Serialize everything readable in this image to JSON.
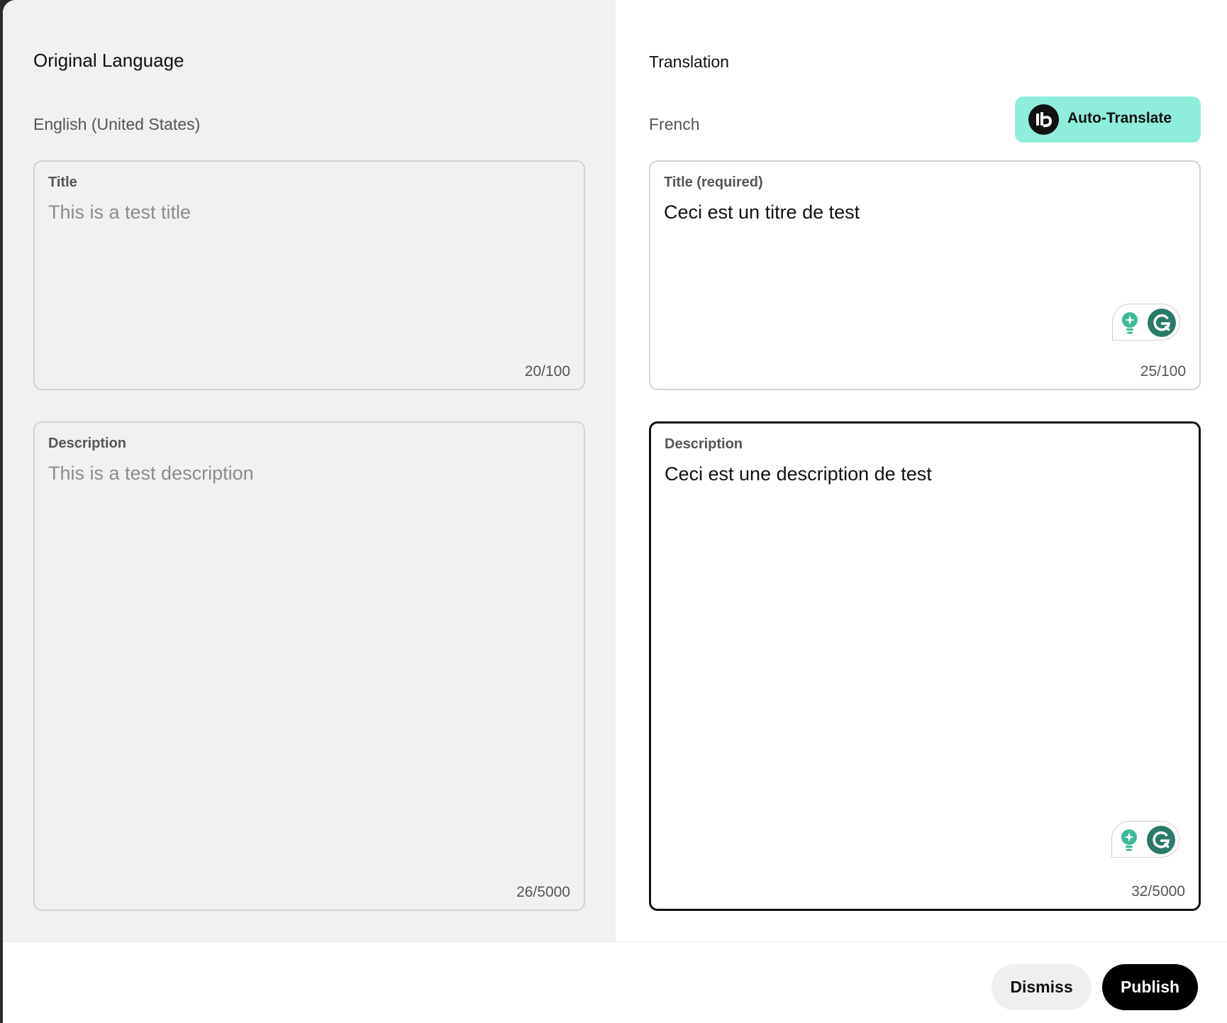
{
  "original": {
    "heading": "Original Language",
    "language": "English (United States)",
    "title_field": {
      "label": "Title",
      "value": "This is a test title",
      "counter": "20/100"
    },
    "description_field": {
      "label": "Description",
      "value": "This is a test description",
      "counter": "26/5000"
    }
  },
  "translation": {
    "heading": "Translation",
    "language": "French",
    "auto_translate_label": "Auto-Translate",
    "title_field": {
      "label": "Title (required)",
      "value": "Ceci est un titre de test",
      "counter": "25/100"
    },
    "description_field": {
      "label": "Description",
      "value": "Ceci est une description de test",
      "counter": "32/5000"
    }
  },
  "footer": {
    "dismiss_label": "Dismiss",
    "publish_label": "Publish"
  },
  "icons": {
    "auto_translate": "auto-translate-logo-icon",
    "assistant_bulb": "bulb-icon",
    "grammarly": "grammarly-icon"
  },
  "colors": {
    "auto_translate_bg": "#8eeedb",
    "grammarly_green": "#2a7a68",
    "bulb_green": "#3fb99b",
    "publish_bg": "#000000"
  }
}
